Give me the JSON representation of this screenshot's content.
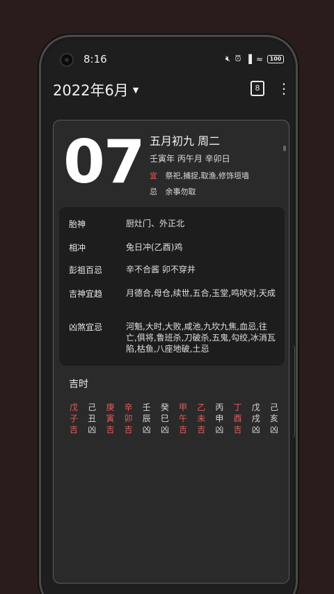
{
  "status": {
    "time": "8:16",
    "icons": [
      "mute-icon",
      "alarm-icon",
      "signal-icon",
      "wifi-icon",
      "battery-icon"
    ],
    "battery": "100"
  },
  "topbar": {
    "month_title": "2022年6月",
    "calendar_day": "8"
  },
  "day": {
    "number": "07",
    "lunar": "五月初九 周二",
    "ganzhi": "壬寅年  丙午月  辛卯日",
    "yi_label": "宜",
    "yi_text": "祭祀,捕捉,取渔,修饰垣墙",
    "ji_label": "忌",
    "ji_text": "余事勿取"
  },
  "info": [
    {
      "key": "胎神",
      "value": "厨灶门、外正北"
    },
    {
      "key": "相冲",
      "value": "兔日冲(乙酉)鸡"
    },
    {
      "key": "彭祖百忌",
      "value": "辛不合酱 卯不穿井"
    },
    {
      "key": "吉神宜趋",
      "value": "月德合,母仓,续世,五合,玉堂,鸣吠对,天成"
    },
    {
      "key": "凶煞宜忌",
      "value": "河魁,大时,大败,咸池,九坎九焦,血忌,往亡,俱将,鲁班杀,刀破杀,五鬼,勾绞,冰消瓦陷,枯鱼,八座地破,土忌"
    }
  ],
  "jishi": {
    "title": "吉时",
    "hours": [
      {
        "stem": "戊",
        "branch": "子",
        "luck": "吉",
        "good": true
      },
      {
        "stem": "己",
        "branch": "丑",
        "luck": "凶",
        "good": false
      },
      {
        "stem": "庚",
        "branch": "寅",
        "luck": "吉",
        "good": true
      },
      {
        "stem": "辛",
        "branch": "卯",
        "luck": "吉",
        "good": true
      },
      {
        "stem": "壬",
        "branch": "辰",
        "luck": "凶",
        "good": false
      },
      {
        "stem": "癸",
        "branch": "巳",
        "luck": "凶",
        "good": false
      },
      {
        "stem": "甲",
        "branch": "午",
        "luck": "吉",
        "good": true
      },
      {
        "stem": "乙",
        "branch": "未",
        "luck": "吉",
        "good": true
      },
      {
        "stem": "丙",
        "branch": "申",
        "luck": "凶",
        "good": false
      },
      {
        "stem": "丁",
        "branch": "酉",
        "luck": "吉",
        "good": true
      },
      {
        "stem": "戊",
        "branch": "戌",
        "luck": "凶",
        "good": false
      },
      {
        "stem": "己",
        "branch": "亥",
        "luck": "凶",
        "good": false
      }
    ]
  },
  "colors": {
    "good": "#e25c5c",
    "bad": "#d8d8d8",
    "background": "#2a1c1c"
  }
}
